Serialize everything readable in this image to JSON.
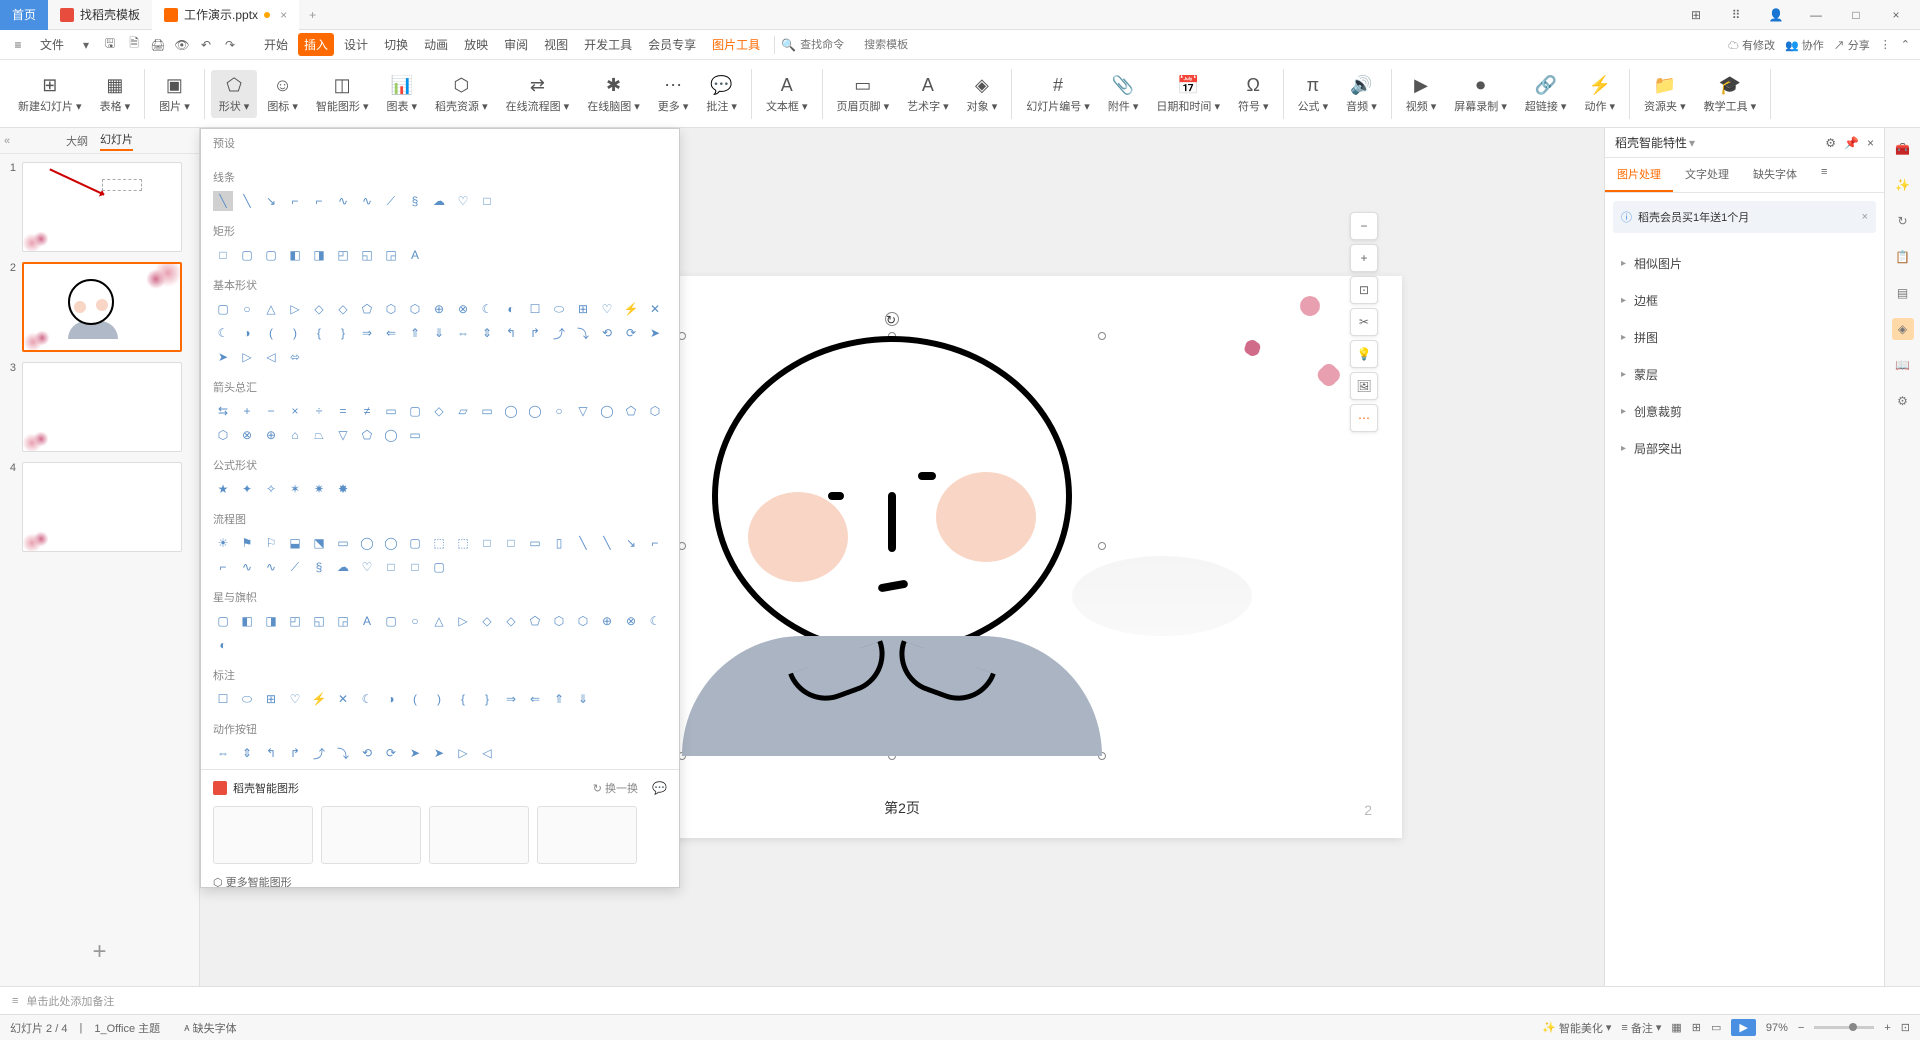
{
  "titlebar": {
    "home": "首页",
    "tab_template": "找稻壳模板",
    "tab_file": "工作演示.pptx"
  },
  "menubar": {
    "file": "文件",
    "items": [
      "开始",
      "插入",
      "设计",
      "切换",
      "动画",
      "放映",
      "审阅",
      "视图",
      "开发工具",
      "会员专享",
      "图片工具"
    ],
    "active_index": 1,
    "search_cmd": "查找命令",
    "search_tpl": "搜索模板",
    "right": {
      "pending": "有修改",
      "collab": "协作",
      "share": "分享"
    }
  },
  "ribbon": {
    "items": [
      {
        "label": "新建幻灯片",
        "icon": "⊞"
      },
      {
        "label": "表格",
        "icon": "▦"
      },
      {
        "label": "图片",
        "icon": "▣"
      },
      {
        "label": "形状",
        "icon": "⬠",
        "selected": true
      },
      {
        "label": "图标",
        "icon": "☺"
      },
      {
        "label": "智能图形",
        "icon": "◫"
      },
      {
        "label": "图表",
        "icon": "📊"
      },
      {
        "label": "稻壳资源",
        "icon": "⬡"
      },
      {
        "label": "在线流程图",
        "icon": "⇄"
      },
      {
        "label": "在线脑图",
        "icon": "✱"
      },
      {
        "label": "更多",
        "icon": "⋯"
      },
      {
        "label": "批注",
        "icon": "💬"
      },
      {
        "label": "文本框",
        "icon": "A"
      },
      {
        "label": "页眉页脚",
        "icon": "▭"
      },
      {
        "label": "艺术字",
        "icon": "A"
      },
      {
        "label": "对象",
        "icon": "◈"
      },
      {
        "label": "幻灯片编号",
        "icon": "#"
      },
      {
        "label": "附件",
        "icon": "📎"
      },
      {
        "label": "日期和时间",
        "icon": "📅"
      },
      {
        "label": "符号",
        "icon": "Ω"
      },
      {
        "label": "公式",
        "icon": "π"
      },
      {
        "label": "音频",
        "icon": "🔊"
      },
      {
        "label": "视频",
        "icon": "▶"
      },
      {
        "label": "屏幕录制",
        "icon": "⏺"
      },
      {
        "label": "超链接",
        "icon": "🔗"
      },
      {
        "label": "动作",
        "icon": "⚡"
      },
      {
        "label": "资源夹",
        "icon": "📁"
      },
      {
        "label": "教学工具",
        "icon": "🎓"
      }
    ]
  },
  "left_panel": {
    "tabs": [
      "大纲",
      "幻灯片"
    ],
    "active_tab": 1,
    "slides": [
      1,
      2,
      3,
      4
    ],
    "active_slide": 2
  },
  "shapes": {
    "sections": [
      {
        "title": "预设",
        "count": 0
      },
      {
        "title": "线条",
        "count": 12
      },
      {
        "title": "矩形",
        "count": 9
      },
      {
        "title": "基本形状",
        "count": 42
      },
      {
        "title": "箭头总汇",
        "count": 28
      },
      {
        "title": "公式形状",
        "count": 6
      },
      {
        "title": "流程图",
        "count": 29
      },
      {
        "title": "星与旗帜",
        "count": 20
      },
      {
        "title": "标注",
        "count": 16
      },
      {
        "title": "动作按钮",
        "count": 12
      }
    ],
    "smart_title": "稻壳智能图形",
    "refresh": "换一换",
    "more": "更多智能图形"
  },
  "right_panel": {
    "title": "稻壳智能特性",
    "tabs": [
      "图片处理",
      "文字处理",
      "缺失字体"
    ],
    "active_tab": 0,
    "notice": "稻壳会员买1年送1个月",
    "options": [
      "相似图片",
      "边框",
      "拼图",
      "蒙层",
      "创意裁剪",
      "局部突出"
    ]
  },
  "float_tools": [
    "−",
    "+",
    "⊡",
    "✂",
    "💡",
    "🖼",
    "⋯"
  ],
  "canvas": {
    "page_text": "第2页",
    "page_num": "2"
  },
  "notes": {
    "placeholder": "单击此处添加备注"
  },
  "statusbar": {
    "slide_info": "幻灯片 2 / 4",
    "theme": "1_Office 主题",
    "missing_font": "缺失字体",
    "beautify": "智能美化",
    "backup": "备注",
    "zoom": "97%"
  }
}
